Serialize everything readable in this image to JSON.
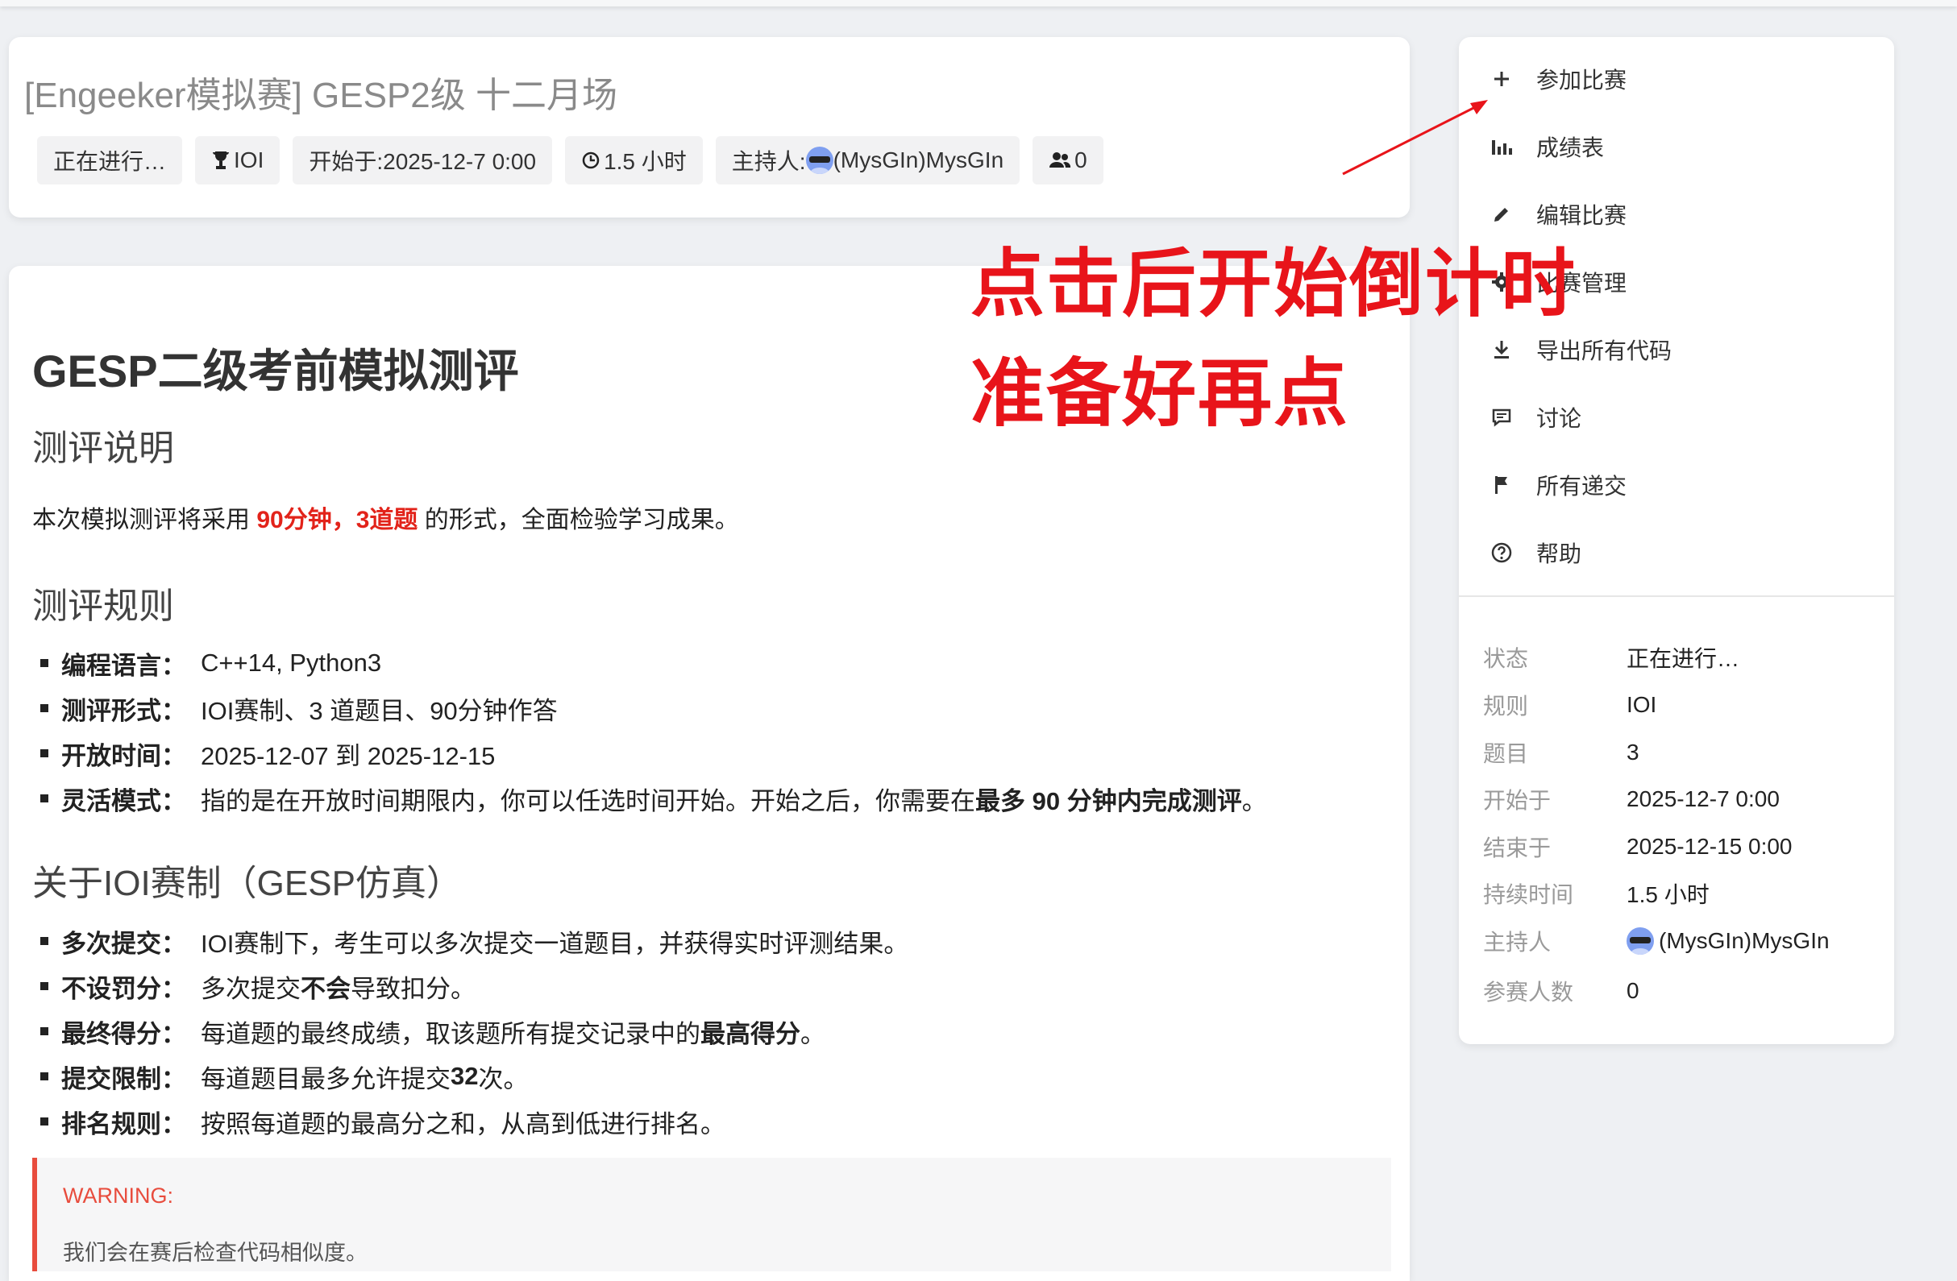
{
  "header": {
    "title": "[Engeeker模拟赛] GESP2级 十二月场",
    "chips": {
      "status": "正在进行…",
      "rule": "IOI",
      "start": "开始于:2025-12-7 0:00",
      "duration": "1.5 小时",
      "host_label": "主持人:",
      "host_name": "(MysGIn)MysGIn",
      "participants": "0"
    }
  },
  "content": {
    "heading": "GESP二级考前模拟测评",
    "section1": "测评说明",
    "intro_pre": "本次模拟测评将采用 ",
    "intro_highlight": "90分钟，3道题",
    "intro_post": " 的形式，全面检验学习成果。",
    "section2": "测评规则",
    "rules": [
      {
        "key": "编程语言：",
        "text": "C++14, Python3"
      },
      {
        "key": "测评形式：",
        "text": "IOI赛制、3 道题目、90分钟作答"
      },
      {
        "key": "开放时间：",
        "text": "2025-12-07 到 2025-12-15"
      },
      {
        "key": "灵活模式：",
        "text": "指的是在开放时间期限内，你可以任选时间开始。开始之后，你需要在",
        "bold": "最多 90 分钟内完成测评",
        "tail": "。"
      }
    ],
    "section3": "关于IOI赛制（GESP仿真）",
    "ioi": [
      {
        "key": "多次提交：",
        "text": "IOI赛制下，考生可以多次提交一道题目，并获得实时评测结果。"
      },
      {
        "key": "不设罚分：",
        "pre": "多次提交",
        "bold": "不会",
        "text": "导致扣分。"
      },
      {
        "key": "最终得分：",
        "text": "每道题的最终成绩，取该题所有提交记录中的",
        "bold": "最高得分",
        "tail": "。"
      },
      {
        "key": "提交限制：",
        "text": "每道题目最多允许提交 ",
        "bold": "32",
        "tail": " 次。"
      },
      {
        "key": "排名规则：",
        "text": "按照每道题的最高分之和，从高到低进行排名。"
      }
    ],
    "warning_title": "WARNING:",
    "warning_body": "我们会在赛后检查代码相似度。"
  },
  "sidebar": {
    "menu": [
      {
        "label": "参加比赛",
        "icon": "plus-icon"
      },
      {
        "label": "成绩表",
        "icon": "bar-chart-icon"
      },
      {
        "label": "编辑比赛",
        "icon": "pencil-icon"
      },
      {
        "label": "比赛管理",
        "icon": "gear-icon"
      },
      {
        "label": "导出所有代码",
        "icon": "download-icon"
      },
      {
        "label": "讨论",
        "icon": "comment-icon"
      },
      {
        "label": "所有递交",
        "icon": "flag-icon"
      },
      {
        "label": "帮助",
        "icon": "help-icon"
      }
    ],
    "info": [
      {
        "label": "状态",
        "value": "正在进行…"
      },
      {
        "label": "规则",
        "value": "IOI"
      },
      {
        "label": "题目",
        "value": "3"
      },
      {
        "label": "开始于",
        "value": "2025-12-7 0:00"
      },
      {
        "label": "结束于",
        "value": "2025-12-15 0:00"
      },
      {
        "label": "持续时间",
        "value": "1.5 小时"
      },
      {
        "label": "主持人",
        "value": "(MysGIn)MysGIn"
      },
      {
        "label": "参赛人数",
        "value": "0"
      }
    ]
  },
  "annotation": {
    "line1": "点击后开始倒计时",
    "line2": "准备好再点",
    "color": "#e8141a"
  }
}
